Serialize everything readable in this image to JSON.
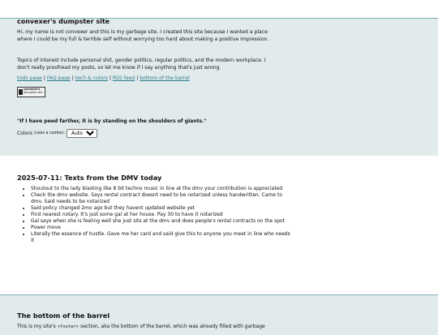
{
  "header": {
    "title": "convexer's dumpster site",
    "intro": "Hi, my name is not convexer and this is my garbage site. I created this site because I wanted a place where I could be my full & terrible self without worrying too hard about making a positive impression.",
    "topics": "Topics of interest include personal shit, gender politics, regular politics, and the modern workplace. I don't really proofread my posts, so let me know if I say anything that's just wrong.",
    "links": [
      {
        "label": "todo page"
      },
      {
        "label": "FAQ page"
      },
      {
        "label": "tech & colors"
      },
      {
        "label": "RSS feed"
      },
      {
        "label": "bottom of the barrel"
      }
    ],
    "separator": "|",
    "badge": {
      "line1": "convexer's",
      "line2": "dumpster site"
    },
    "quote": "\"If I have peed farther, it is by standing on the shoulders of giants.\"",
    "colors": {
      "label": "Colors",
      "note": "(uses a cookie):",
      "selected": "Auto"
    }
  },
  "post": {
    "title": "2025-07-11:  Texts from the DMV today",
    "items": [
      "Shoutout to the lady blasting like 8 bit techno music in line at the dmv your contribution is appreciated",
      "Check the dmv website. Says rental contract doesnt need to be notarized unless handwritten. Came to dmv. Said needs to be notarized",
      "Said policy changed 2mo ago but they havent updated website yet",
      "Find nearest notary. It's just some gal at her house. Pay 30 to have it notarized",
      "Gal says when she is feeling well she just sits at the dmv and does people's rental contracts on the spot",
      "Power move",
      "Literally the essence of hustle. Gave me her card and said give this to anyone you meet in line who needs it"
    ]
  },
  "footer": {
    "title": "The bottom of the barrel",
    "text_before": "This is my site's ",
    "code": "<footer>",
    "text_after": " section, aka the bottom of the barrel, which was already filled with garbage"
  },
  "colors": {
    "band": "#e1ebec",
    "border": "#7fb3b8",
    "link": "#2a7a8c"
  }
}
